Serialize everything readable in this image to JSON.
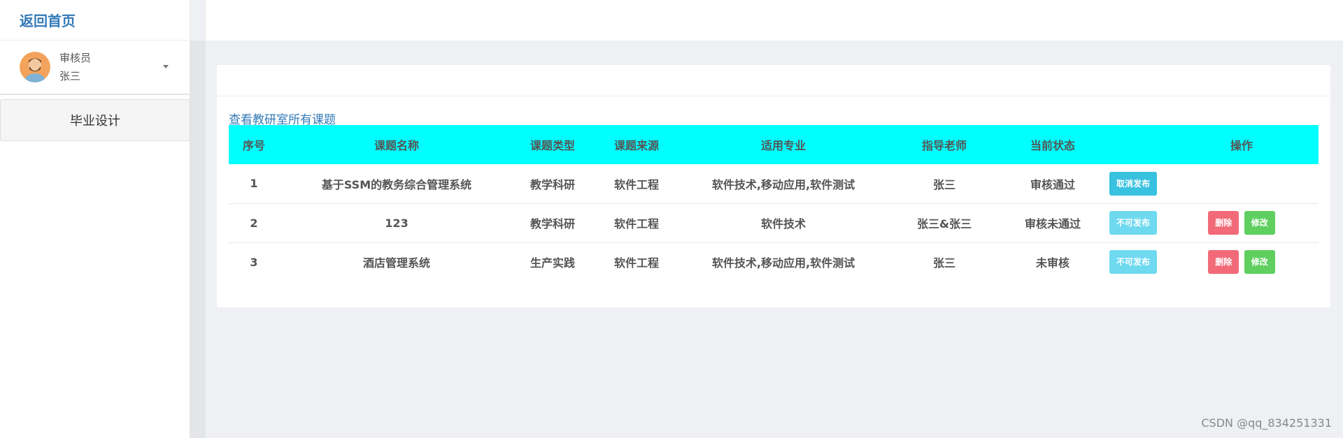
{
  "sidebar": {
    "brand": "返回首页",
    "user": {
      "role": "审核员",
      "name": "张三"
    },
    "menu": [
      {
        "label": "毕业设计"
      }
    ]
  },
  "main": {
    "link": "查看教研室所有课题",
    "table": {
      "headers": [
        "序号",
        "课题名称",
        "课题类型",
        "课题来源",
        "适用专业",
        "指导老师",
        "当前状态",
        "",
        "操作"
      ],
      "rows": [
        {
          "no": "1",
          "title": "基于SSM的教务综合管理系统",
          "type": "教学科研",
          "source": "软件工程",
          "major": "软件技术,移动应用,软件测试",
          "teacher": "张三",
          "status": "审核通过",
          "publish": "取消发布"
        },
        {
          "no": "2",
          "title": "123",
          "type": "教学科研",
          "source": "软件工程",
          "major": "软件技术",
          "teacher": "张三&张三",
          "status": "审核未通过",
          "publish": "不可发布",
          "delete": "删除",
          "edit": "修改"
        },
        {
          "no": "3",
          "title": "酒店管理系统",
          "type": "生产实践",
          "source": "软件工程",
          "major": "软件技术,移动应用,软件测试",
          "teacher": "张三",
          "status": "未审核",
          "publish": "不可发布",
          "delete": "删除",
          "edit": "修改"
        }
      ]
    }
  },
  "watermark": "CSDN @qq_834251331",
  "colors": {
    "header_bg": "#00ffff",
    "link": "#337ab7",
    "btn_info": "#39c1e0",
    "btn_danger": "#f26a78",
    "btn_success": "#5fcf5f"
  }
}
